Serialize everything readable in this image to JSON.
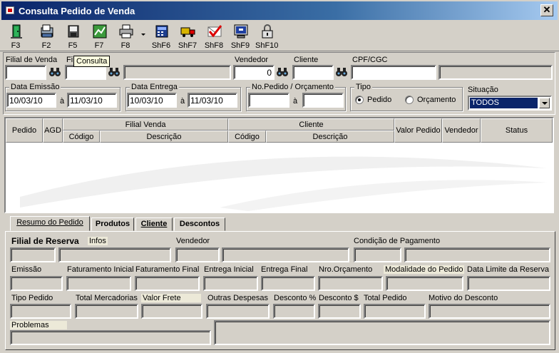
{
  "window": {
    "title": "Consulta Pedido de Venda",
    "close": "✕"
  },
  "toolbar": [
    {
      "key": "F3",
      "icon": "exit-door-icon"
    },
    {
      "key": "F2",
      "icon": "new-document-icon"
    },
    {
      "key": "F5",
      "icon": "save-icon"
    },
    {
      "key": "F7",
      "icon": "spreadsheet-icon"
    },
    {
      "key": "F8",
      "icon": "printer-icon"
    },
    {
      "key": "ShF6",
      "icon": "cash-register-icon"
    },
    {
      "key": "ShF7",
      "icon": "delivery-truck-icon"
    },
    {
      "key": "ShF8",
      "icon": "approve-check-icon"
    },
    {
      "key": "ShF9",
      "icon": "monitor-icon"
    },
    {
      "key": "ShF10",
      "icon": "padlock-icon"
    }
  ],
  "tooltip": "Consulta",
  "filters": {
    "filial_venda_label": "Filial de Venda",
    "filial_label": "Fi",
    "vendedor_label": "Vendedor",
    "vendedor_value": "0",
    "cliente_label": "Cliente",
    "cpf_label": "CPF/CGC",
    "data_emissao_label": "Data Emissão",
    "data_emissao_from": "10/03/10",
    "data_emissao_to": "11/03/10",
    "data_entrega_label": "Data Entrega",
    "data_entrega_from": "10/03/10",
    "data_entrega_to": "11/03/10",
    "range_sep": "à",
    "pedido_label": "No.Pedido / Orçamento",
    "tipo_label": "Tipo",
    "tipo_pedido": "Pedido",
    "tipo_orcamento": "Orçamento",
    "situacao_label": "Situação",
    "situacao_value": "TODOS"
  },
  "grid": {
    "pedido": "Pedido",
    "agd": "AGD",
    "filial_venda": "Filial Venda",
    "cliente": "Cliente",
    "codigo": "Código",
    "descricao": "Descrição",
    "valor_pedido": "Valor Pedido",
    "vendedor": "Vendedor",
    "status": "Status"
  },
  "tabs": {
    "resumo": "Resumo do Pedido",
    "produtos": "Produtos",
    "cliente": "Cliente",
    "descontos": "Descontos"
  },
  "resumo": {
    "filial_reserva": "Filial de Reserva",
    "infos": "Infos",
    "vendedor": "Vendedor",
    "condicao_pagamento": "Condição de Pagamento",
    "emissao": "Emissão",
    "faturamento_inicial": "Faturamento Inicial",
    "faturamento_final": "Faturamento Final",
    "entrega_inicial": "Entrega Inicial",
    "entrega_final": "Entrega Final",
    "nro_orcamento": "Nro.Orçamento",
    "modalidade_pedido": "Modalidade do Pedido",
    "data_limite_reserva": "Data Limite da Reserva",
    "tipo_pedido": "Tipo Pedido",
    "total_mercadorias": "Total Mercadorias",
    "valor_frete": "Valor Frete",
    "outras_despesas": "Outras Despesas",
    "desconto_pct": "Desconto %",
    "desconto_val": "Desconto $",
    "total_pedido": "Total Pedido",
    "motivo_desconto": "Motivo do Desconto",
    "problemas": "Problemas"
  }
}
